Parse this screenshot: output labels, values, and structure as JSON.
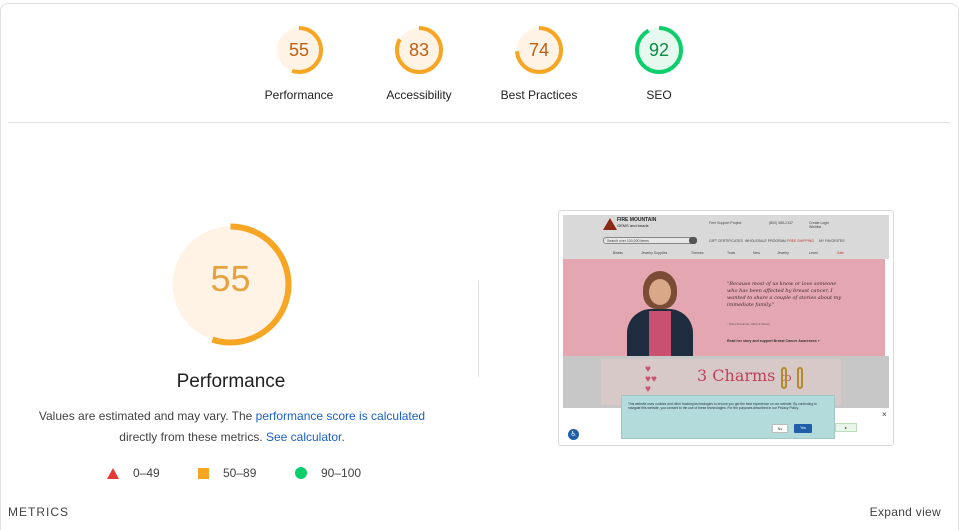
{
  "categories": [
    {
      "id": "performance",
      "score": "55",
      "label": "Performance",
      "fraction": 0.55,
      "color": "#f6a623",
      "text_color": "#c05e10",
      "bg": "#fff3e6"
    },
    {
      "id": "accessibility",
      "score": "83",
      "label": "Accessibility",
      "fraction": 0.83,
      "color": "#f6a623",
      "text_color": "#c05e10",
      "bg": "#fff3e6"
    },
    {
      "id": "best-practices",
      "score": "74",
      "label": "Best Practices",
      "fraction": 0.74,
      "color": "#f6a623",
      "text_color": "#c05e10",
      "bg": "#fff3e6"
    },
    {
      "id": "seo",
      "score": "92",
      "label": "SEO",
      "fraction": 0.92,
      "color": "#0cce6b",
      "text_color": "#0a8a43",
      "bg": "#e6f9ef"
    }
  ],
  "performance": {
    "score": "55",
    "fraction": 0.55,
    "title": "Performance",
    "desc_prefix": "Values are estimated and may vary. The ",
    "desc_link1": "performance score is calculated",
    "desc_middle": " directly from these metrics. ",
    "desc_link2": "See calculator",
    "desc_suffix": "."
  },
  "legend": [
    {
      "shape": "triangle",
      "range": "0–49",
      "color": "#e53935"
    },
    {
      "shape": "square",
      "range": "50–89",
      "color": "#f6a623"
    },
    {
      "shape": "circle",
      "range": "90–100",
      "color": "#0cce6b"
    }
  ],
  "thumbnail": {
    "logo_line1": "FIRE MOUNTAIN",
    "logo_line2": "GEMS and beads",
    "search_placeholder": "Search over 100,000 items",
    "header_links": [
      "Free Support Project",
      "(800) 355-2137",
      "Create Login",
      "Wishlist"
    ],
    "top_links": [
      "GIFT CERTIFICATES",
      "WHOLESALE PROGRAM",
      "FREE SHIPPING",
      "MY FAVORITES"
    ],
    "nav": [
      "Beads",
      "Jewelry Supplies",
      "Themes",
      "Tools",
      "New",
      "Jewelry",
      "Learn",
      "Sale"
    ],
    "quote": "\"Because most of us know or love someone who has been affected by breast cancer, I wanted to share a couple of stories about my immediate family.\"",
    "quote_sig": "- Chris Friedman, CEO & Owner",
    "quote_cta": "Read her story and support Breast Cancer Awareness »",
    "promo_text": "3 Charms",
    "promo_to": "to",
    "cookie_text": "This website uses cookies and other tracking technologies to ensure you get the best experience on our website. By continuing to navigate this website, you consent to the use of these technologies. For the purposes described in our Privacy Policy.",
    "cookie_no": "No",
    "cookie_yes": "Yes",
    "close": "×"
  },
  "footer": {
    "metrics_label": "METRICS",
    "expand_view": "Expand view"
  }
}
